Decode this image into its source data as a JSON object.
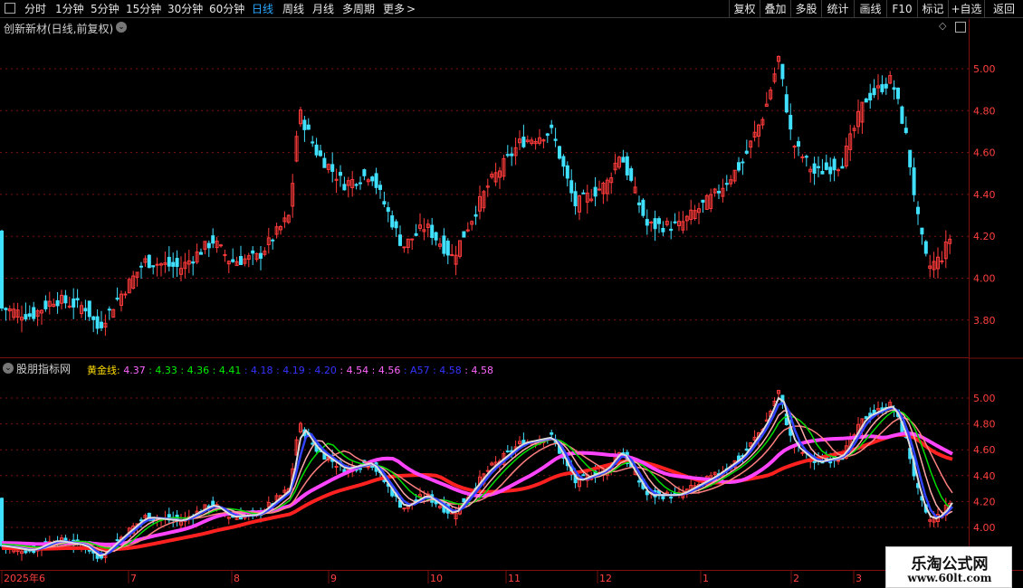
{
  "toolbar": {
    "periods": [
      {
        "label": "分时",
        "active": false
      },
      {
        "label": "1分钟",
        "active": false
      },
      {
        "label": "5分钟",
        "active": false
      },
      {
        "label": "15分钟",
        "active": false
      },
      {
        "label": "30分钟",
        "active": false
      },
      {
        "label": "60分钟",
        "active": false
      },
      {
        "label": "日线",
        "active": true
      },
      {
        "label": "周线",
        "active": false
      },
      {
        "label": "月线",
        "active": false
      },
      {
        "label": "多周期",
        "active": false
      },
      {
        "label": "更多",
        "active": false
      }
    ],
    "more_arrow": ">",
    "right_buttons": [
      "复权",
      "叠加",
      "多股",
      "统计",
      "画线",
      "F10",
      "标记",
      "+自选",
      "返回"
    ]
  },
  "main_panel": {
    "title": "创新新材(日线,前复权)",
    "y_ticks": [
      "5.00",
      "4.80",
      "4.60",
      "4.40",
      "4.20",
      "4.00",
      "3.80"
    ]
  },
  "sub_panel": {
    "title": "股朋指标网",
    "legend_label": "黄金线",
    "legend_items": [
      {
        "text": "4.37",
        "color": "#ff66ff"
      },
      {
        "text": "4.33",
        "color": "#00ee00"
      },
      {
        "text": "4.36",
        "color": "#00ee00"
      },
      {
        "text": "4.41",
        "color": "#00ee00"
      },
      {
        "text": "4.18",
        "color": "#3333ff"
      },
      {
        "text": "4.19",
        "color": "#3333ff"
      },
      {
        "text": "4.20",
        "color": "#3333ff"
      },
      {
        "text": "4.54",
        "color": "#ff66ff"
      },
      {
        "text": "4.56",
        "color": "#ff66ff"
      },
      {
        "text": "A57",
        "color": "#3333ff"
      },
      {
        "text": "4.58",
        "color": "#3333ff"
      },
      {
        "text": "4.58",
        "color": "#ff66ff"
      }
    ],
    "y_ticks": [
      "5.00",
      "4.80",
      "4.60",
      "4.40",
      "4.20",
      "4.00"
    ]
  },
  "time_axis": {
    "labels": [
      "2025年6",
      "7",
      "8",
      "9",
      "10",
      "11",
      "12",
      "1",
      "2",
      "3"
    ]
  },
  "watermark": {
    "line1": "乐淘公式网",
    "line2": "www.60lt.com"
  },
  "colors": {
    "up": "#ff3b3b",
    "down": "#40e0ff",
    "grid": "#7a1010",
    "axis_text": "#ff4040"
  }
}
